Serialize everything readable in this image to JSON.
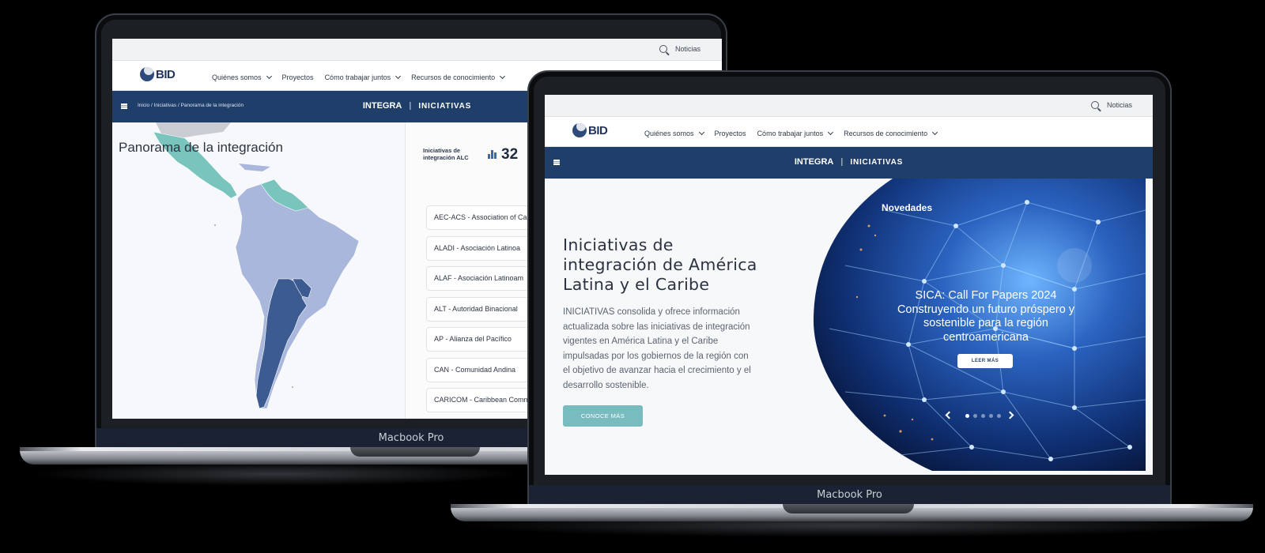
{
  "left_laptop": {
    "topbar": {
      "news": "Noticias"
    },
    "nav": {
      "logo": "BID",
      "menu": [
        {
          "label": "Quiénes somos",
          "dropdown": true
        },
        {
          "label": "Proyectos",
          "dropdown": false
        },
        {
          "label": "Cómo trabajar juntos",
          "dropdown": true
        },
        {
          "label": "Recursos de conocimiento",
          "dropdown": true
        }
      ]
    },
    "band": {
      "breadcrumb": [
        "Inicio",
        "Iniciativas",
        "Panorama de la integración"
      ],
      "brand": "INTEGRA",
      "section": "INICIATIVAS"
    },
    "map_title": "Panorama de la integración",
    "stat": {
      "label": "Iniciativas de integración ALC",
      "value": "32"
    },
    "initiatives": [
      "AEC-ACS - Association of Ca",
      "ALADI - Asociación Latinoa",
      "ALAF - Asociación Latinoam",
      "ALT - Autoridad Binacional",
      "AP - Alianza del Pacífico",
      "CAN - Comunidad Andina",
      "CARICOM - Caribbean Comm"
    ],
    "device_label": "Macbook Pro"
  },
  "right_laptop": {
    "topbar": {
      "news": "Noticias"
    },
    "nav": {
      "logo": "BID",
      "menu": [
        {
          "label": "Quiénes somos",
          "dropdown": true
        },
        {
          "label": "Proyectos",
          "dropdown": false
        },
        {
          "label": "Cómo trabajar juntos",
          "dropdown": true
        },
        {
          "label": "Recursos de conocimiento",
          "dropdown": true
        }
      ]
    },
    "band": {
      "brand": "INTEGRA",
      "section": "INICIATIVAS"
    },
    "hero": {
      "title": "Iniciativas de integración de América Latina y el Caribe",
      "description": "INICIATIVAS consolida y ofrece información actualizada sobre las iniciativas de integración vigentes en América Latina y el Caribe impulsadas por los gobiernos de la región con el objetivo de avanzar hacia el crecimiento y el desarrollo sostenible.",
      "button": "CONOCE MÁS"
    },
    "carousel": {
      "label": "Novedades",
      "slide_title": "SICA: Call For Papers 2024 Construyendo un futuro próspero y sostenible para la región centroamericana",
      "button": "LEER MÁS",
      "slide_count": 5,
      "active_slide": 1
    },
    "device_label": "Macbook Pro"
  },
  "colors": {
    "brand_band": "#1f3f6a",
    "accent_teal": "#78bcc0",
    "map_light": "#aab7dc",
    "map_dark": "#3c5b91",
    "map_teal": "#79c4bd"
  }
}
